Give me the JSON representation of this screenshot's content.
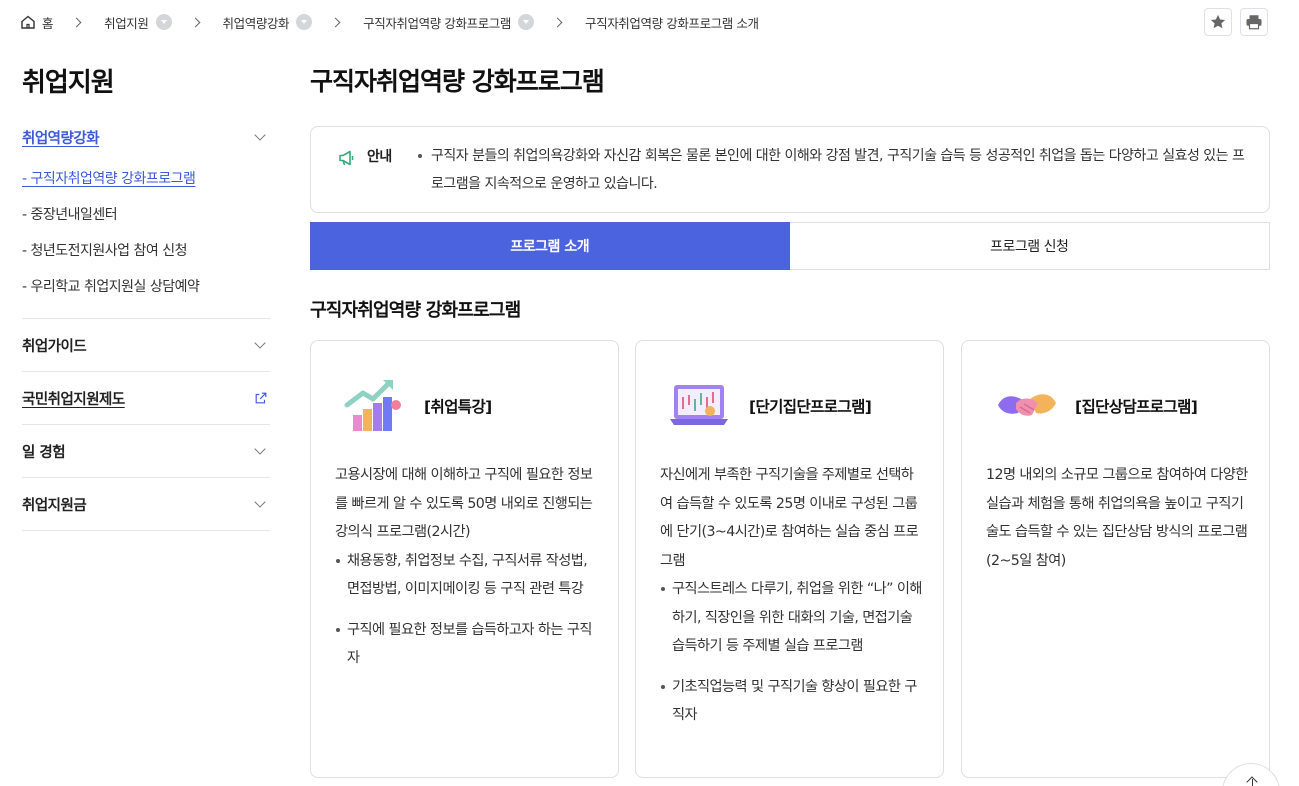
{
  "breadcrumb": {
    "home": "홈",
    "items": [
      "취업지원",
      "취업역량강화",
      "구직자취업역량 강화프로그램",
      "구직자취업역량 강화프로그램 소개"
    ]
  },
  "sidebar": {
    "title": "취업지원",
    "groups": [
      {
        "label": "취업역량강화",
        "sub": [
          "- 구직자취업역량 강화프로그램",
          "- 중장년내일센터",
          "- 청년도전지원사업 참여 신청",
          "- 우리학교 취업지원실 상담예약"
        ]
      },
      {
        "label": "취업가이드"
      },
      {
        "label": "국민취업지원제도"
      },
      {
        "label": "일 경험"
      },
      {
        "label": "취업지원금"
      }
    ]
  },
  "main": {
    "title": "구직자취업역량 강화프로그램",
    "notice": {
      "label": "안내",
      "text": "구직자 분들의 취업의욕강화와 자신감 회복은 물론 본인에 대한 이해와 강점 발견, 구직기술 습득 등 성공적인 취업을 돕는 다양하고 실효성 있는 프로그램을 지속적으로 운영하고 있습니다."
    },
    "tabs": [
      "프로그램 소개",
      "프로그램 신청"
    ],
    "section_title": "구직자취업역량 강화프로그램",
    "cards": [
      {
        "title": "[취업특강]",
        "desc": "고용시장에 대해 이해하고 구직에 필요한 정보를 빠르게 알 수 있도록 50명 내외로 진행되는 강의식 프로그램(2시간)",
        "bullets": [
          "채용동향, 취업정보 수집, 구직서류 작성법, 면접방법, 이미지메이킹 등 구직 관련 특강",
          "구직에 필요한 정보를 습득하고자 하는 구직자"
        ]
      },
      {
        "title": "[단기집단프로그램]",
        "desc": "자신에게 부족한 구직기술을 주제별로 선택하여 습득할 수 있도록 25명 이내로 구성된 그룹에 단기(3~4시간)로 참여하는 실습 중심 프로그램",
        "bullets": [
          "구직스트레스 다루기, 취업을 위한 “나” 이해하기, 직장인을 위한 대화의 기술, 면접기술 습득하기 등 주제별 실습 프로그램",
          "기초직업능력 및 구직기술 향상이 필요한 구직자"
        ]
      },
      {
        "title": "[집단상담프로그램]",
        "desc": "12명 내외의 소규모 그룹으로 참여하여 다양한 실습과 체험을 통해 취업의욕을 높이고 구직기술도 습득할 수 있는 집단상담 방식의 프로그램(2~5일 참여)",
        "bullets": []
      }
    ]
  },
  "colors": {
    "accent": "#4b63de",
    "link": "#3d5ad8",
    "border": "#dcdfe3"
  }
}
